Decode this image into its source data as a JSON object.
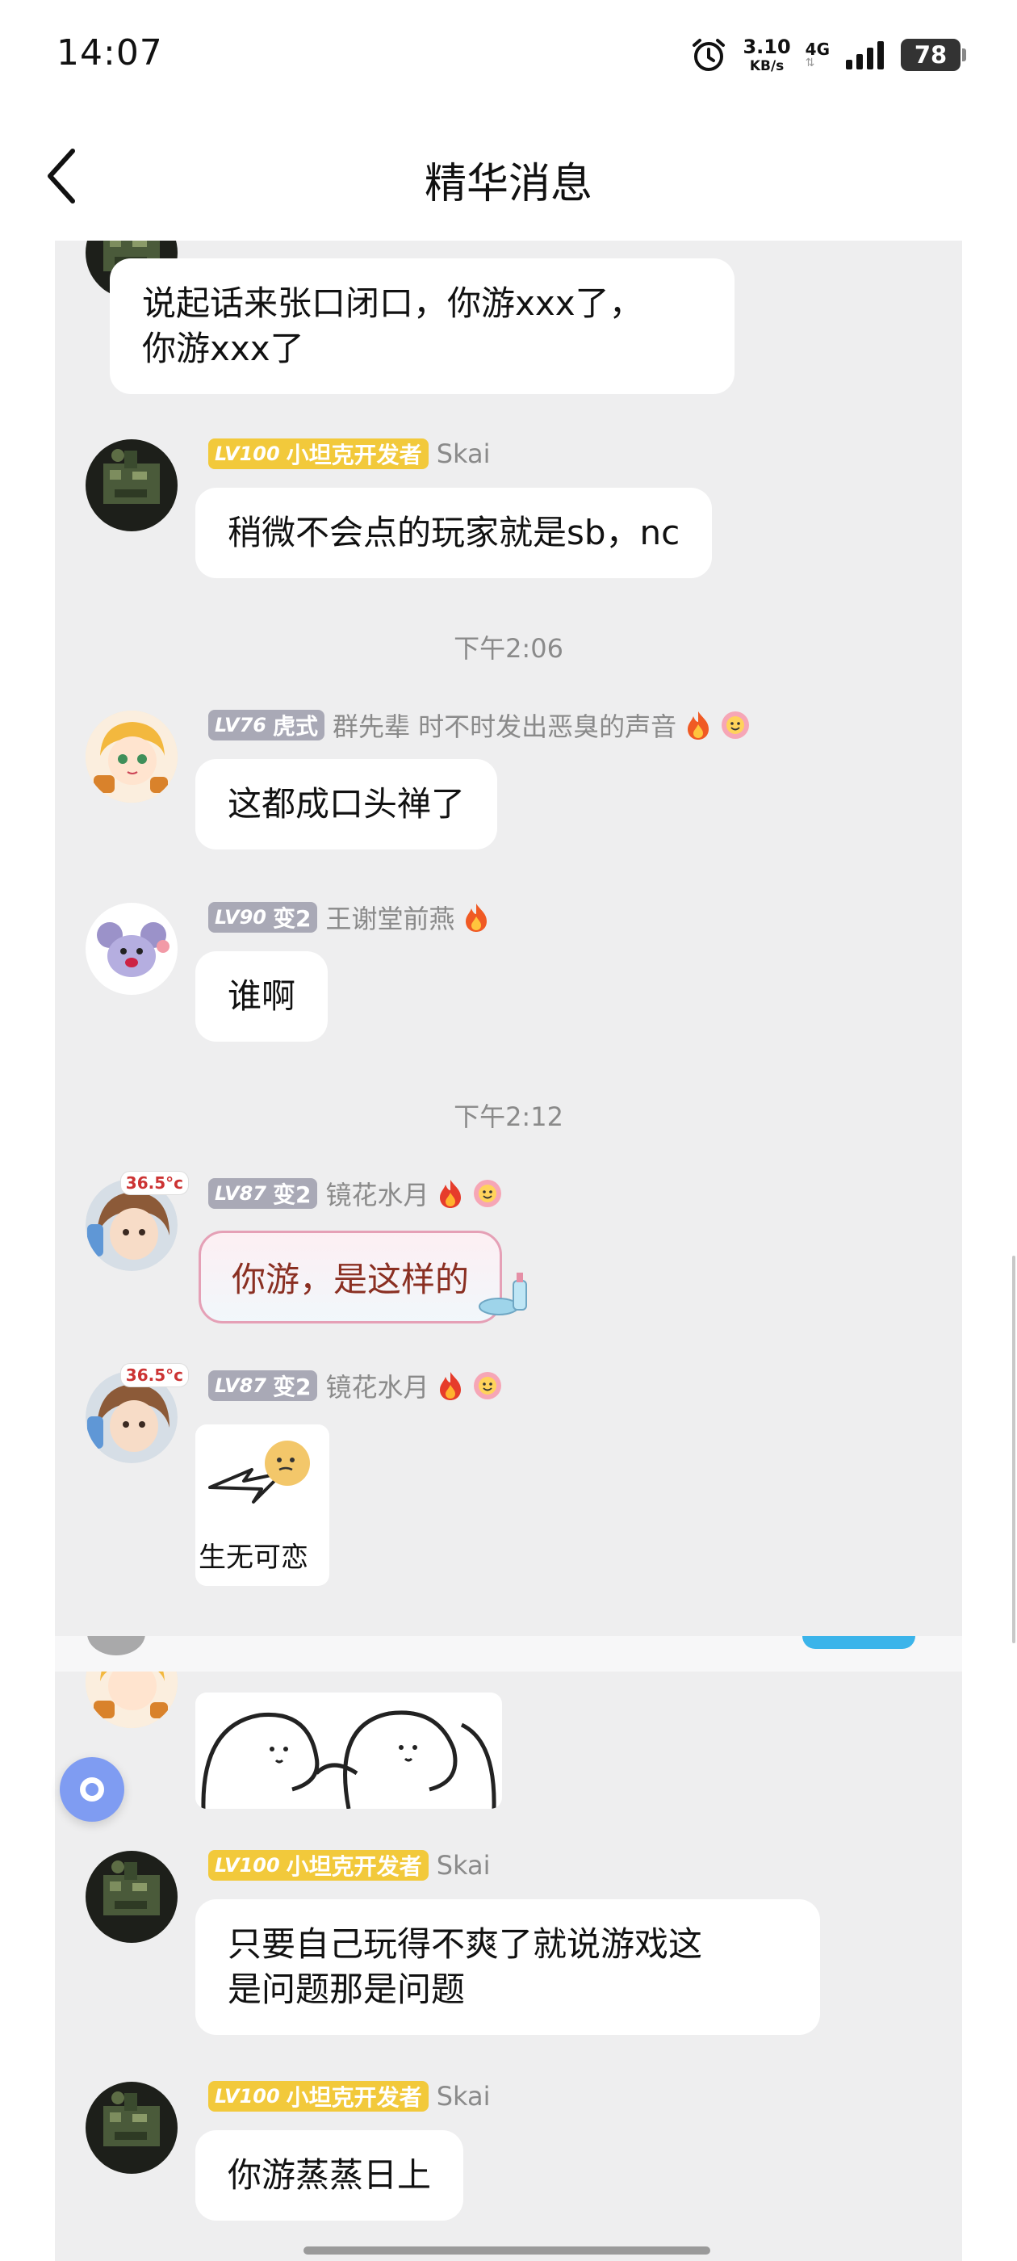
{
  "status_bar": {
    "time": "14:07",
    "net_speed": "3.10",
    "net_speed_unit": "KB/s",
    "network_type": "4G",
    "battery": "78",
    "icons": [
      "alarm-icon",
      "signal-icon",
      "battery-icon"
    ]
  },
  "header": {
    "title": "精华消息",
    "back_icon": "chevron-left-icon"
  },
  "time_separators": [
    "下午2:06",
    "下午2:12"
  ],
  "messages": [
    {
      "id": "m0",
      "text": "说起话来张口闭口，你游xxx了，\n你游xxx了"
    },
    {
      "id": "m1",
      "level": "LV100",
      "title": "小坦克开发者",
      "name": "Skai",
      "text": "稍微不会点的玩家就是sb，nc"
    },
    {
      "id": "m2",
      "level": "LV76",
      "title": "虎式",
      "name": "群先辈 时不时发出恶臭的声音",
      "text": "这都成口头禅了"
    },
    {
      "id": "m3",
      "level": "LV90",
      "title": "变2",
      "name": "王谢堂前燕",
      "text": "谁啊"
    },
    {
      "id": "m4",
      "level": "LV87",
      "title": "变2",
      "name": "镜花水月",
      "text": "你游，是这样的",
      "avatar_badge": "36.5°c"
    },
    {
      "id": "m5",
      "level": "LV87",
      "title": "变2",
      "name": "镜花水月",
      "sticker_caption": "生无可恋",
      "avatar_badge": "36.5°c"
    },
    {
      "id": "m6",
      "sticker": "two-bears-sticker"
    },
    {
      "id": "m7",
      "level": "LV100",
      "title": "小坦克开发者",
      "name": "Skai",
      "text": "只要自己玩得不爽了就说游戏这\n是问题那是问题"
    },
    {
      "id": "m8",
      "level": "LV100",
      "title": "小坦克开发者",
      "name": "Skai",
      "text": "你游蒸蒸日上"
    }
  ],
  "colors": {
    "chat_background": "#eeeeef",
    "bubble": "#ffffff",
    "level_gold": "#f2c93b",
    "level_gray": "#a9a9b6",
    "float_button": "#7f9cf2"
  }
}
